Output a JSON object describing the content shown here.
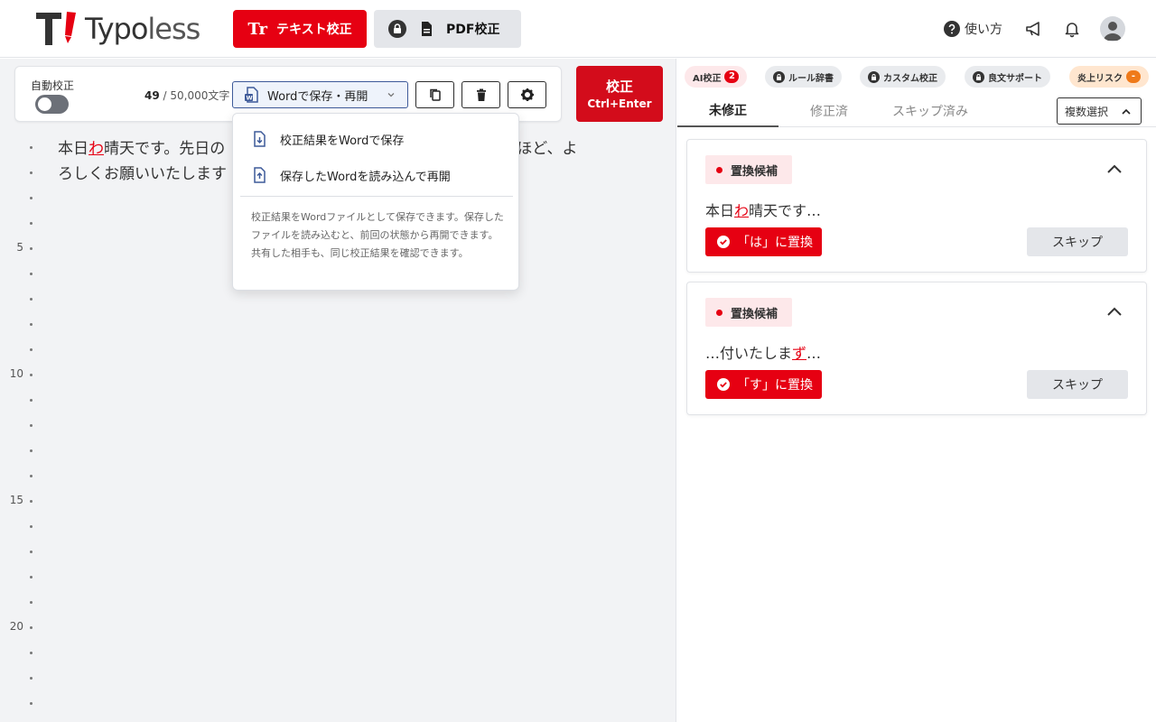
{
  "header": {
    "logo_mark": "T!",
    "logo_text_a": "Typo",
    "logo_text_b": "less",
    "text_proof_icon": "Tr",
    "text_proof_label": "テキスト校正",
    "pdf_proof_label": "PDF校正",
    "help_label": "使い方",
    "icons": [
      "help-icon",
      "megaphone-icon",
      "bell-icon",
      "user-avatar-icon"
    ]
  },
  "toolbar": {
    "auto_label": "自動校正",
    "auto_enabled": false,
    "char_count": "49",
    "char_limit": "/ 50,000文字",
    "word_button_label": "Wordで保存・再開",
    "proof_label": "校正",
    "proof_shortcut": "Ctrl+Enter"
  },
  "gutter": {
    "line_numbers": [
      "5",
      "10",
      "15",
      "20"
    ]
  },
  "editor": {
    "text_before": "本日",
    "error1": "わ",
    "text_mid": "晴天です。先日の",
    "text_hidden_gap": "",
    "text_visible_right": "ご確認のほど、よ",
    "line2": "ろしくお願いいたしま",
    "error2": "す"
  },
  "dropdown": {
    "item_save": "校正結果をWordで保存",
    "item_load": "保存したWordを読み込んで再開",
    "note": "校正結果をWordファイルとして保存できます。保存したファイルを読み込むと、前回の状態から再開できます。共有した相手も、同じ校正結果を確認できます。"
  },
  "right": {
    "chips": {
      "ai": "AI校正",
      "ai_count": "2",
      "rule": "ルール辞書",
      "custom": "カスタム校正",
      "support": "良文サポート",
      "risk": "炎上リスク",
      "risk_count": "-"
    },
    "tabs": {
      "unfixed": "未修正",
      "fixed": "修正済",
      "skipped": "スキップ済み"
    },
    "multi_select": "複数選択",
    "cards": [
      {
        "tag": "置換候補",
        "text_before": "本日",
        "highlight": "わ",
        "text_after": "晴天です…",
        "replace_label": "「は」に置換",
        "skip_label": "スキップ"
      },
      {
        "tag": "置換候補",
        "text_before": "…付いたしま",
        "highlight": "ず",
        "text_after": "…",
        "replace_label": "「す」に置換",
        "skip_label": "スキップ"
      }
    ]
  },
  "colors": {
    "brand_red": "#e60012",
    "proof_red": "#d30c1b",
    "word_blue": "#3d5a99"
  }
}
